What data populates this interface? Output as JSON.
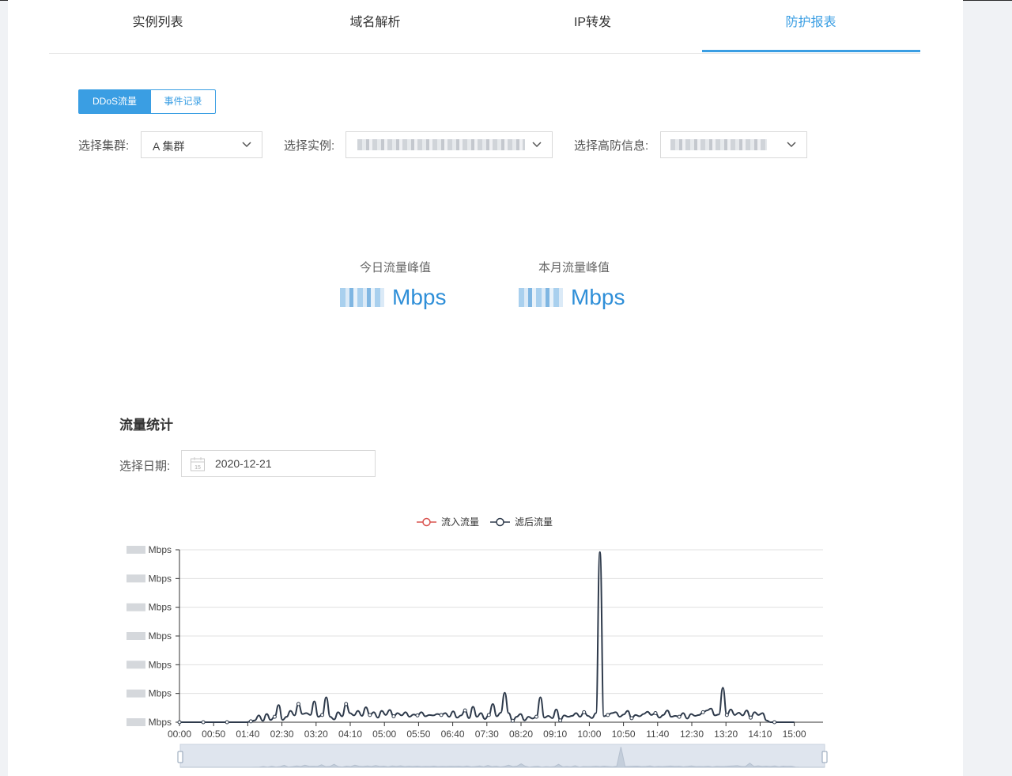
{
  "tabs": [
    {
      "label": "实例列表",
      "active": false
    },
    {
      "label": "域名解析",
      "active": false
    },
    {
      "label": "IP转发",
      "active": false
    },
    {
      "label": "防护报表",
      "active": true
    }
  ],
  "segmented": {
    "on": "DDoS流量",
    "off": "事件记录"
  },
  "filters": {
    "cluster_label": "选择集群:",
    "cluster_value": "A 集群",
    "instance_label": "选择实例:",
    "protection_label": "选择高防信息:"
  },
  "peaks": {
    "today_label": "今日流量峰值",
    "today_unit": "Mbps",
    "month_label": "本月流量峰值",
    "month_unit": "Mbps"
  },
  "stats": {
    "title": "流量统计",
    "date_label": "选择日期:",
    "date_value": "2020-12-21",
    "calendar_day": "15"
  },
  "legend": [
    {
      "name": "流入流量",
      "color": "#d9534f"
    },
    {
      "name": "滤后流量",
      "color": "#2e3a4b"
    }
  ],
  "chart_data": {
    "type": "line",
    "x_ticks": [
      "00:00",
      "00:50",
      "01:40",
      "02:30",
      "03:20",
      "04:10",
      "05:00",
      "05:50",
      "06:40",
      "07:30",
      "08:20",
      "09:10",
      "10:00",
      "10:50",
      "11:40",
      "12:30",
      "13:20",
      "14:10",
      "15:00"
    ],
    "y_tick_unit": "Mbps",
    "y_tick_count": 7,
    "grid": true,
    "legend_position": "top-center",
    "series": [
      {
        "name": "滤后流量",
        "color": "#2e3a4b",
        "values": [
          0,
          0,
          0,
          0,
          0,
          0,
          0,
          0,
          0,
          0,
          0,
          0,
          0,
          0,
          0,
          0,
          0,
          0,
          0.2,
          0.4,
          1.5,
          0.3,
          1.8,
          0.5,
          1.2,
          3.8,
          0.5,
          1.2,
          2.5,
          1.5,
          4.0,
          1.8,
          2.0,
          1.6,
          4.6,
          1.2,
          1.6,
          5.5,
          1.2,
          0.6,
          2.2,
          1.3,
          4.0,
          2.0,
          1.5,
          2.5,
          1.4,
          3.3,
          1.6,
          2.2,
          1.0,
          2.5,
          1.6,
          2.7,
          1.3,
          2.0,
          1.5,
          2.2,
          1.2,
          1.7,
          1.5,
          2.2,
          1.3,
          1.6,
          1.5,
          1.8,
          1.6,
          2.0,
          1.2,
          2.4,
          1.0,
          1.5,
          2.6,
          0.9,
          3.4,
          1.2,
          2.0,
          0.7,
          1.6,
          4.0,
          1.3,
          2.1,
          6.5,
          2.0,
          0.3,
          1.2,
          1.8,
          0.4,
          1.2,
          0.8,
          1.2,
          5.5,
          1.0,
          1.4,
          0.9,
          2.8,
          0.4,
          1.5,
          1.2,
          1.4,
          2.0,
          1.2,
          2.2,
          1.4,
          0.9,
          2.0,
          37.5,
          1.3,
          1.6,
          2.0,
          2.2,
          1.2,
          1.7,
          2.5,
          0.9,
          1.6,
          1.3,
          1.8,
          2.3,
          1.6,
          2.0,
          1.0,
          1.6,
          2.6,
          1.2,
          1.4,
          1.2,
          2.0,
          0.8,
          1.8,
          1.4,
          1.6,
          2.2,
          2.6,
          3.0,
          1.5,
          1.7,
          7.6,
          1.6,
          2.8,
          1.6,
          2.1,
          1.5,
          2.6,
          1.0,
          2.2,
          1.6,
          2.0,
          0.4,
          0,
          0,
          0,
          0,
          0,
          0,
          0
        ]
      }
    ],
    "ylim": [
      0,
      38
    ]
  }
}
